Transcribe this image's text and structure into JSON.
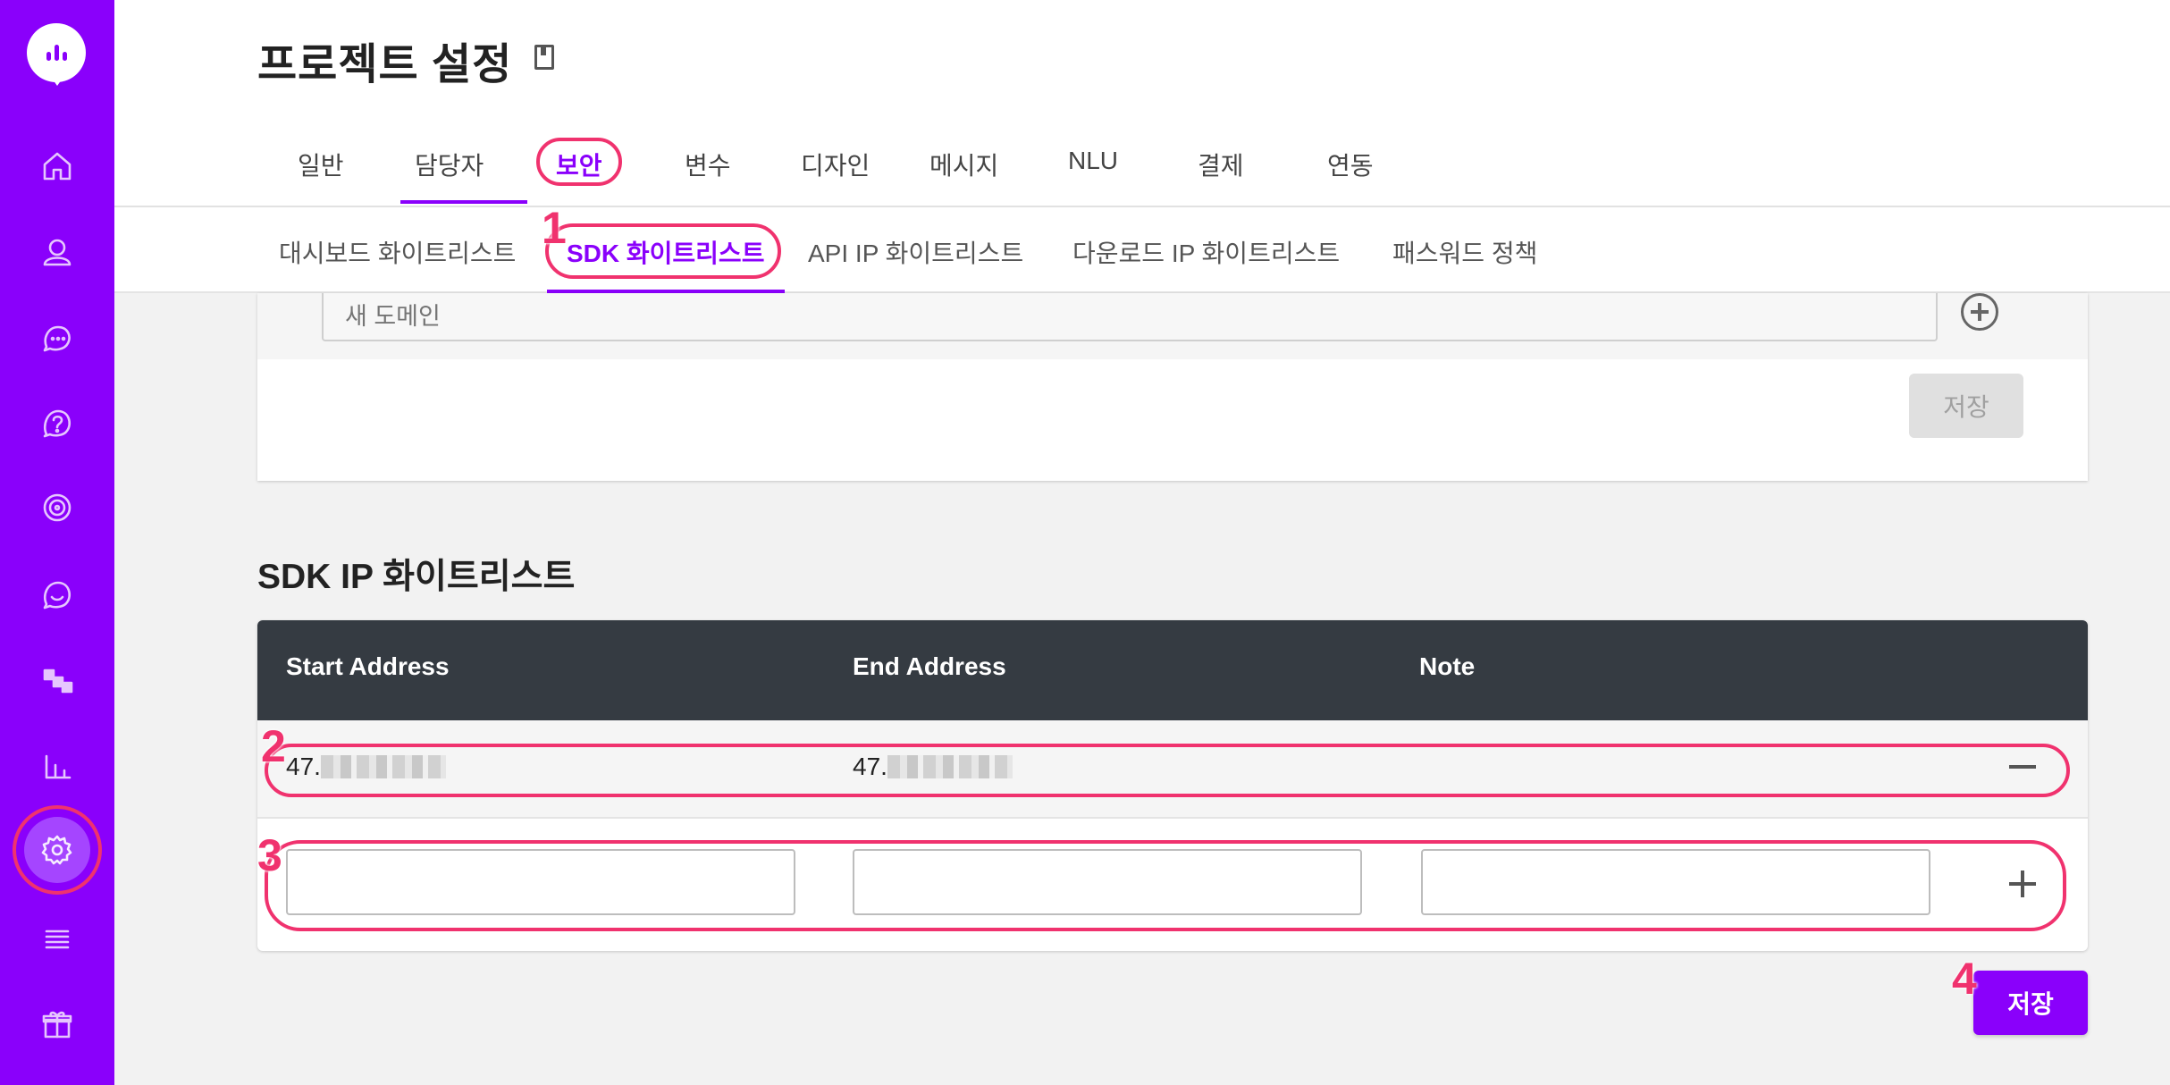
{
  "header": {
    "title": "프로젝트 설정"
  },
  "tabs": [
    "일반",
    "담당자",
    "보안",
    "변수",
    "디자인",
    "메시지",
    "NLU",
    "결제",
    "연동"
  ],
  "subtabs": [
    "대시보드 화이트리스트",
    "SDK 화이트리스트",
    "API IP 화이트리스트",
    "다운로드 IP 화이트리스트",
    "패스워드 정책"
  ],
  "domain_section": {
    "new_domain_placeholder": "새 도메인",
    "save_label": "저장"
  },
  "sdk_ip": {
    "title": "SDK IP 화이트리스트",
    "columns": [
      "Start Address",
      "End Address",
      "Note"
    ],
    "rows": [
      {
        "start": "47.",
        "end": "47.",
        "note": ""
      }
    ],
    "save_label": "저장"
  },
  "annotations": [
    "1",
    "2",
    "3",
    "4"
  ],
  "sidebar": {
    "icons": [
      "home-icon",
      "user-icon",
      "chat-icon",
      "help-icon",
      "target-icon",
      "message-icon",
      "flow-icon",
      "stats-icon",
      "settings-icon",
      "menu-icon",
      "gift-icon"
    ]
  },
  "colors": {
    "primary": "#8a00fb",
    "annotation": "#f0326e",
    "table_header": "#353b42"
  }
}
